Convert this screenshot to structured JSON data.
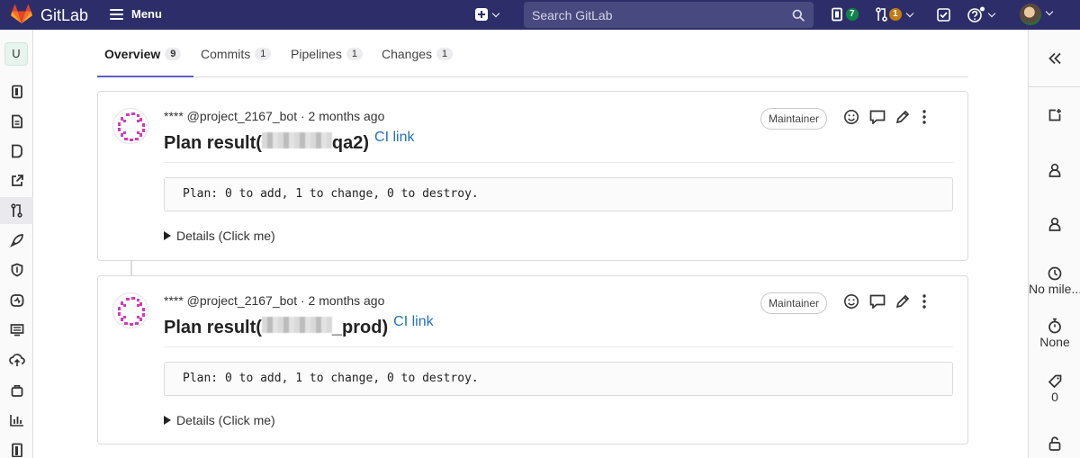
{
  "topnav": {
    "brand": "GitLab",
    "menu_label": "Menu",
    "search_placeholder": "Search GitLab",
    "issues_count": "7",
    "mr_count": "1"
  },
  "project": {
    "avatar_letter": "U"
  },
  "tabs": [
    {
      "label": "Overview",
      "count": "9",
      "active": true
    },
    {
      "label": "Commits",
      "count": "1"
    },
    {
      "label": "Pipelines",
      "count": "1"
    },
    {
      "label": "Changes",
      "count": "1"
    }
  ],
  "notes": [
    {
      "author": "**** @project_2167_bot · 2 months ago",
      "role": "Maintainer",
      "title_prefix": "Plan result(",
      "title_suffix": "qa2)",
      "ci_link": "CI link",
      "code": "Plan: 0 to add, 1 to change, 0 to destroy.",
      "details": "Details (Click me)"
    },
    {
      "author": "**** @project_2167_bot · 2 months ago",
      "role": "Maintainer",
      "title_prefix": "Plan result(",
      "title_suffix": "_prod)",
      "ci_link": "CI link",
      "code": "Plan: 0 to add, 1 to change, 0 to destroy.",
      "details": "Details (Click me)"
    }
  ],
  "right_sidebar": {
    "milestone": "No mile...",
    "time_tracking": "None",
    "labels_count": "0"
  },
  "colors": {
    "nav_bg": "#2d2e69",
    "link": "#1f70c1",
    "tab_active_underline": "#5a5ecd",
    "badge_green": "#108548",
    "badge_orange": "#c17d10"
  }
}
